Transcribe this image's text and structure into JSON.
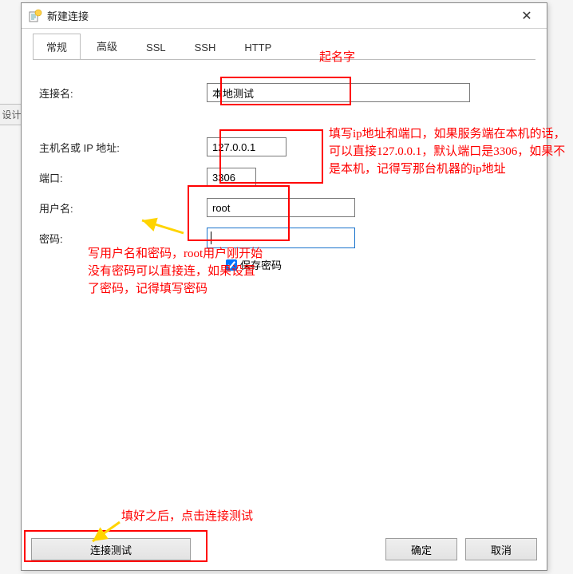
{
  "bg_label": "设计",
  "dialog": {
    "title": "新建连接",
    "tabs": [
      "常规",
      "高级",
      "SSL",
      "SSH",
      "HTTP"
    ],
    "active_tab": 0,
    "fields": {
      "conn_name_label": "连接名:",
      "conn_name_value": "本地测试",
      "host_label": "主机名或 IP 地址:",
      "host_value": "127.0.0.1",
      "port_label": "端口:",
      "port_value": "3306",
      "user_label": "用户名:",
      "user_value": "root",
      "pass_label": "密码:",
      "pass_value": "",
      "save_pass_label": "保存密码"
    },
    "buttons": {
      "test": "连接测试",
      "ok": "确定",
      "cancel": "取消"
    }
  },
  "annotations": {
    "a1": "起名字",
    "a2": "填写ip地址和端口，如果服务端在本机的话，可以直接127.0.0.1，默认端口是3306，如果不是本机，记得写那台机器的ip地址",
    "a3": "写用户名和密码，root用户刚开始没有密码可以直接连，如果设置了密码，记得填写密码",
    "a4": "填好之后，点击连接测试"
  }
}
